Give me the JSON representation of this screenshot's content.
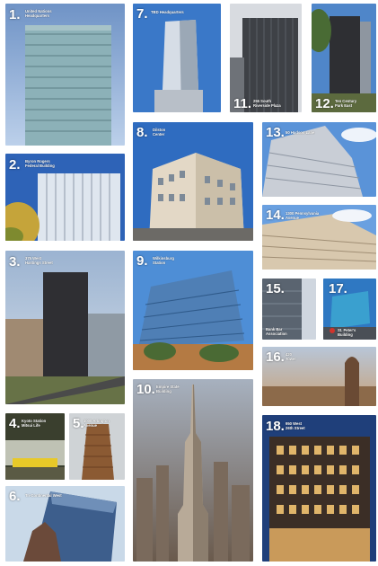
{
  "tiles": [
    {
      "num": "1.",
      "caption": "United Nations\nHeadquarters"
    },
    {
      "num": "2.",
      "caption": "Byron Rogers\nFederal Building"
    },
    {
      "num": "3.",
      "caption": "375 West\nHastings Street"
    },
    {
      "num": "4.",
      "caption": "Kyoto Station\nMitsui Life"
    },
    {
      "num": "5.",
      "caption": "1000 Arlington\nAvenue"
    },
    {
      "num": "6.",
      "caption": "Tri-Continental West"
    },
    {
      "num": "7.",
      "caption": "TBD Headquarters"
    },
    {
      "num": "8.",
      "caption": "Dilston\nCenter"
    },
    {
      "num": "9.",
      "caption": "Wilkinsburg\nStation"
    },
    {
      "num": "10.",
      "caption": "Empire State\nBuilding"
    },
    {
      "num": "11.",
      "caption": "255 South\nRiverside Plaza"
    },
    {
      "num": "12.",
      "caption": "Ten Century\nPark East"
    },
    {
      "num": "13.",
      "caption": "50 Hudson Lane"
    },
    {
      "num": "14.",
      "caption": "1300 Pennsylvania\nAvenue"
    },
    {
      "num": "15.",
      "caption": "Bank Bar\nAssociation"
    },
    {
      "num": "16.",
      "caption": "420\nTower"
    },
    {
      "num": "17.",
      "caption": "St. Peter's\nBuilding"
    },
    {
      "num": "18.",
      "caption": "950 West\n26th Street"
    }
  ]
}
